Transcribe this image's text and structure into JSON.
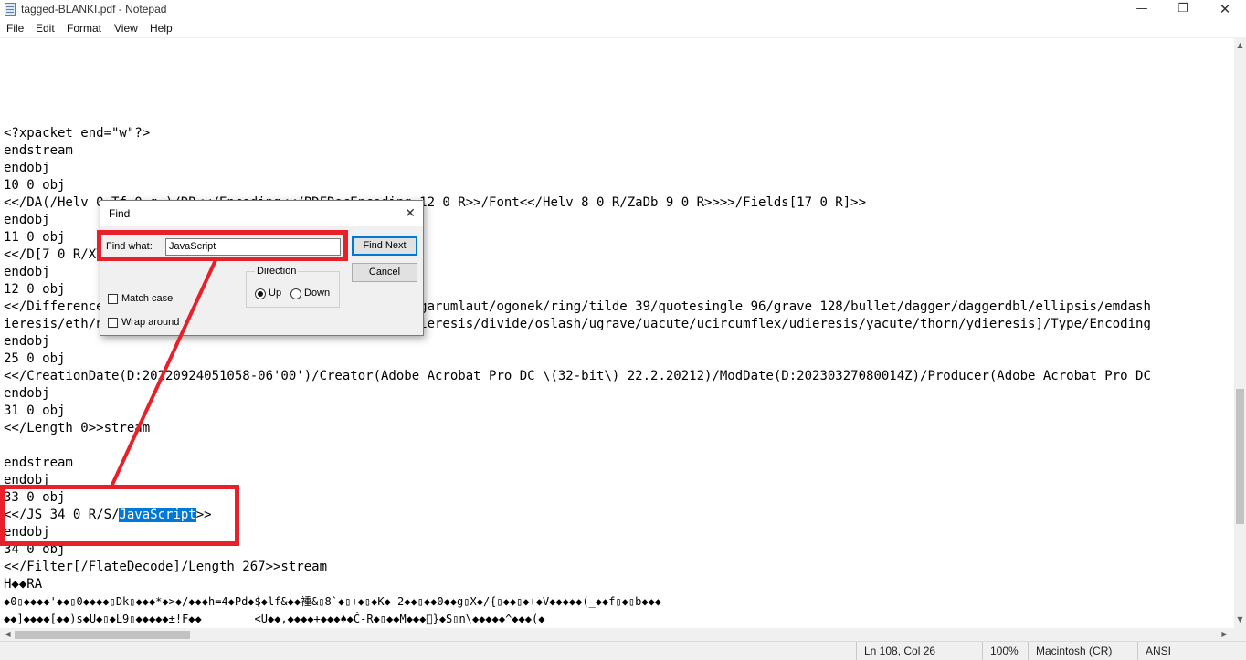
{
  "window": {
    "title": "tagged-BLANKI.pdf - Notepad",
    "minimize_glyph": "—",
    "maximize_glyph": "❐",
    "close_glyph": "✕"
  },
  "menu": {
    "items": [
      "File",
      "Edit",
      "Format",
      "View",
      "Help"
    ]
  },
  "editor": {
    "lines": [
      "<?xpacket end=\"w\"?>",
      "endstream",
      "endobj",
      "10 0 obj",
      "<</DA(/Helv 0 Tf 0 g )/DR<</Encoding<</PDFDocEncoding 12 0 R>>/Font<</Helv 8 0 R/ZaDb 9 0 R>>>>/Fields[17 0 R]>>",
      "endobj",
      "11 0 obj",
      "<</D[7 0 R/XYZ",
      "endobj",
      "12 0 obj",
      "<</Differences[24/breve/caron/circumflex/dotaccent/hungarumlaut/ogonek/ring/tilde 39/quotesingle 96/grave 128/bullet/dagger/daggerdbl/ellipsis/emdash",
      "ieresis/eth/ntilde/ograve/oacute/ocircumflex/otilde/odieresis/divide/oslash/ugrave/uacute/ucircumflex/udieresis/yacute/thorn/ydieresis]/Type/Encoding",
      "endobj",
      "25 0 obj",
      "<</CreationDate(D:20220924051058-06'00')/Creator(Adobe Acrobat Pro DC \\(32-bit\\) 22.2.20212)/ModDate(D:20230327080014Z)/Producer(Adobe Acrobat Pro DC",
      "endobj",
      "31 0 obj",
      "<</Length 0>>stream",
      "",
      "endstream",
      "endobj",
      "33 0 obj"
    ],
    "js_line_prefix": "<</JS 34 0 R/S/",
    "js_line_highlight": "JavaScript",
    "js_line_suffix": ">>",
    "lines_after": [
      "endobj",
      "34 0 obj",
      "<</Filter[/FlateDecode]/Length 267>>stream",
      "H◆◆RA",
      "◆0▯◆◆◆◆'◆◆▯0◆◆◆◆▯Dk▯◆◆◆*◆>◆/◆◆◆h=4◆Pd◆$◆lf&◆◆褈&▯8`◆▯+◆▯◆K◆-2◆◆▯◆◆0◆◆g▯X◆/{▯◆◆▯◆+◆V◆◆◆◆◆(_◆◆f▯◆▯b◆◆◆",
      "◆◆]◆◆◆◆[◆◆)s◆U◆▯◆L9▯◆◆◆◆◆±!F◆◆        <U◆◆,◆◆◆◆+◆◆◆♠◆Ĉ-R◆▯◆◆M◆◆◆⃝}◆S▯n\\◆◆◆◆◆^◆◆◆(◆"
    ]
  },
  "find_dialog": {
    "title": "Find",
    "find_what_label": "Find what:",
    "find_what_value": "JavaScript",
    "find_next_label": "Find Next",
    "cancel_label": "Cancel",
    "match_case_label": "Match case",
    "match_case_checked": false,
    "wrap_around_label": "Wrap around",
    "wrap_around_checked": false,
    "direction_label": "Direction",
    "up_label": "Up",
    "down_label": "Down",
    "direction_selected": "Up"
  },
  "status_bar": {
    "position": "Ln 108, Col 26",
    "zoom": "100%",
    "line_endings": "Macintosh (CR)",
    "encoding": "ANSI"
  },
  "colors": {
    "annotation_red": "#e8202a",
    "selection_blue": "#0078d7"
  }
}
